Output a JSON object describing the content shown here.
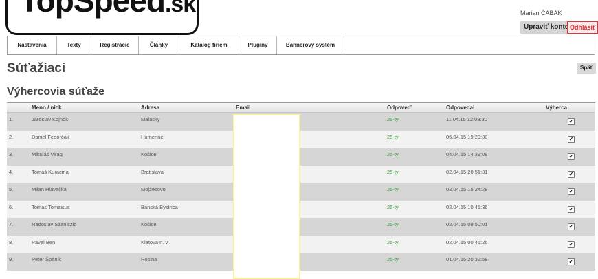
{
  "logo": {
    "main": "TopSpeed",
    "suffix": ".sk"
  },
  "user": {
    "name": "Marian ČABÁK",
    "edit_label": "Upraviť konto",
    "logout_label": "Odhlásiť"
  },
  "nav": [
    "Nastavenia",
    "Texty",
    "Registrácie",
    "Články",
    "Katalóg firiem",
    "Pluginy",
    "Bannerový systém"
  ],
  "page": {
    "title": "Súťažiaci",
    "back_label": "Späť"
  },
  "section": {
    "title": "Výhercovia súťaže"
  },
  "table": {
    "columns": {
      "name": "Meno / nick",
      "address": "Adresa",
      "email": "Email",
      "answer": "Odpoveď",
      "answered": "Odpovedal",
      "winner": "Výherca"
    },
    "rows": [
      {
        "num": "1.",
        "name": "Jaroslav Kojnok",
        "address": "Malacky",
        "answer": "25-ty",
        "answered": "11.04.15 12:09:30",
        "winner": true
      },
      {
        "num": "2.",
        "name": "Daniel Fedorčák",
        "address": "Humenne",
        "answer": "25-ty",
        "answered": "05.04.15 19:29:30",
        "winner": true
      },
      {
        "num": "3.",
        "name": "Mikuláš Virág",
        "address": "Košice",
        "answer": "25-ty",
        "answered": "04.04.15 14:39:08",
        "winner": true
      },
      {
        "num": "4.",
        "name": "Tomáš Kuracina",
        "address": "Bratislava",
        "answer": "25-ty",
        "answered": "02.04.15 20:51:31",
        "winner": true
      },
      {
        "num": "5.",
        "name": "Milan Hlavačka",
        "address": "Mojzesovo",
        "answer": "25-ty",
        "answered": "02.04.15 15:24:28",
        "winner": true
      },
      {
        "num": "6.",
        "name": "Tomas Tomaisus",
        "address": "Banská Bystrica",
        "answer": "25-ty",
        "answered": "02.04.15 10:45:36",
        "winner": true
      },
      {
        "num": "7.",
        "name": "Radoslav Szaniszlo",
        "address": "Košice",
        "answer": "25-ty",
        "answered": "02.04.15 09:50:01",
        "winner": true
      },
      {
        "num": "8.",
        "name": "Pavel Ben",
        "address": "Klatova n. v.",
        "answer": "25-ty",
        "answered": "02.04.15 00:45:26",
        "winner": true
      },
      {
        "num": "9.",
        "name": "Peter Špánik",
        "address": "Rosina",
        "answer": "25-ty",
        "answered": "01.04.15 20:32:58",
        "winner": true
      }
    ]
  }
}
